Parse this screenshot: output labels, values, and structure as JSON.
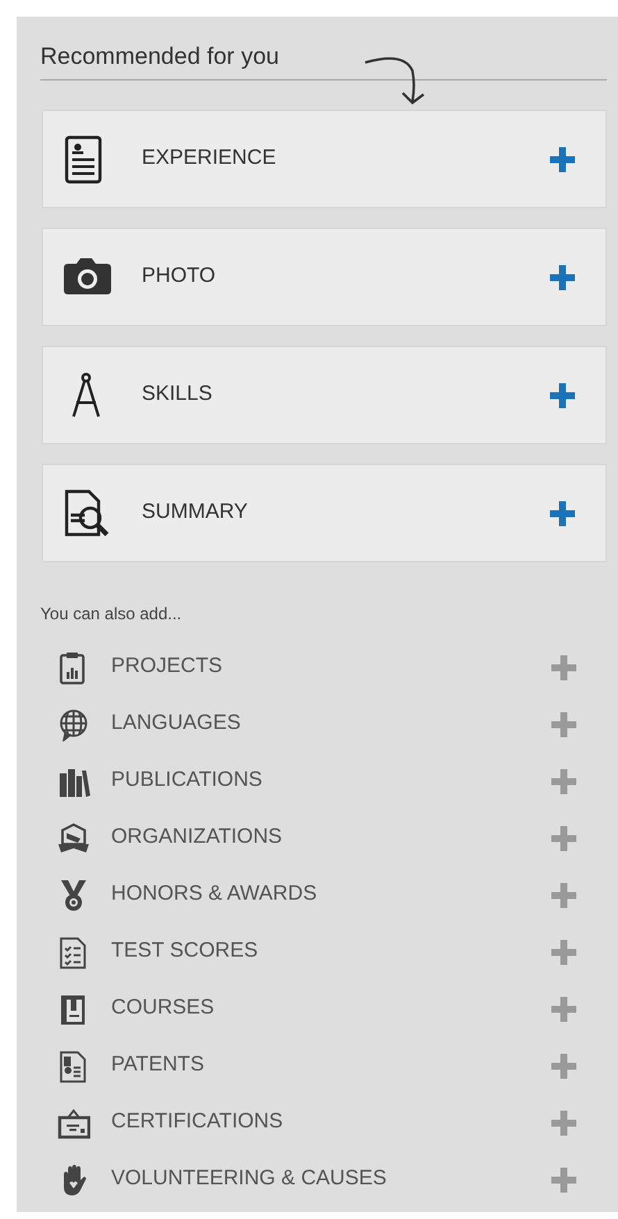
{
  "heading": "Recommended for you",
  "recommended": [
    {
      "label": "EXPERIENCE"
    },
    {
      "label": "PHOTO"
    },
    {
      "label": "SKILLS"
    },
    {
      "label": "SUMMARY"
    }
  ],
  "more_heading": "You can also add...",
  "more": [
    {
      "label": "PROJECTS"
    },
    {
      "label": "LANGUAGES"
    },
    {
      "label": "PUBLICATIONS"
    },
    {
      "label": "ORGANIZATIONS"
    },
    {
      "label": "HONORS & AWARDS"
    },
    {
      "label": "TEST SCORES"
    },
    {
      "label": "COURSES"
    },
    {
      "label": "PATENTS"
    },
    {
      "label": "CERTIFICATIONS"
    },
    {
      "label": "VOLUNTEERING & CAUSES"
    }
  ]
}
